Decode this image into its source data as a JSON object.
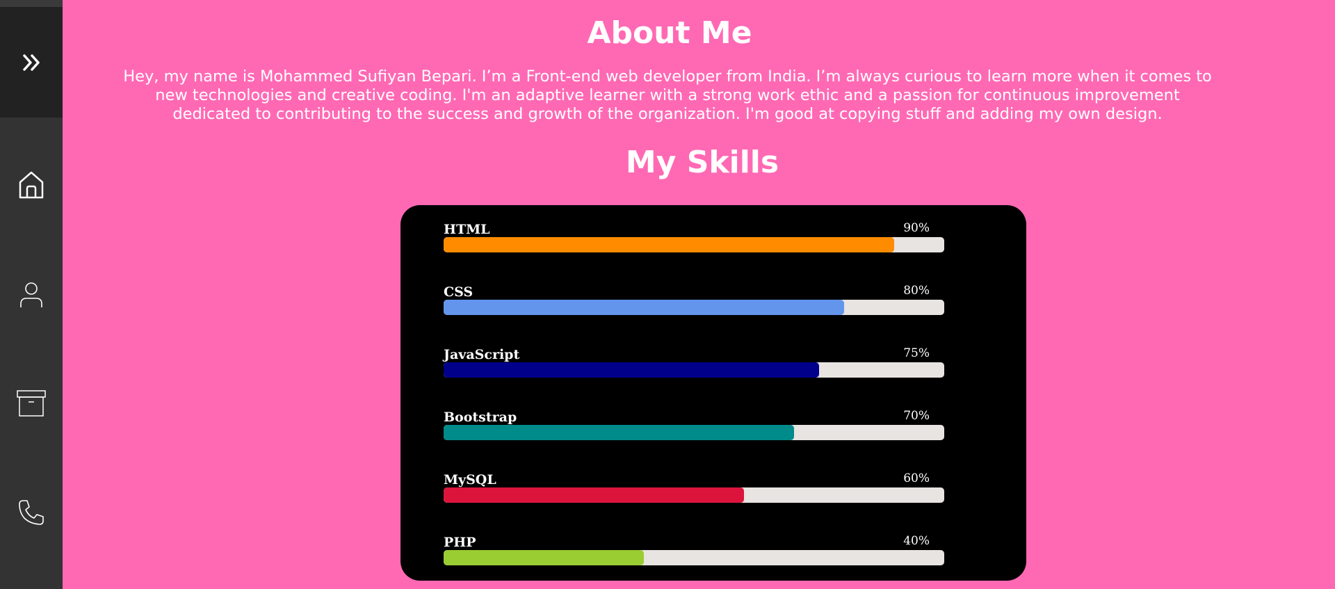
{
  "sidebar": {
    "toggle_icon": "double-chevron-right-icon",
    "items": [
      {
        "icon": "home-icon"
      },
      {
        "icon": "user-icon"
      },
      {
        "icon": "archive-box-icon"
      },
      {
        "icon": "phone-icon"
      }
    ]
  },
  "about": {
    "title": "About Me",
    "text": "Hey, my name is Mohammed Sufiyan Bepari. I’m a Front-end web developer from India. I’m always curious to learn more when it comes to new technologies and creative coding. I'm an adaptive learner with a strong work ethic and a passion for continuous improvement dedicated to contributing to the success and growth of the organization. I'm good at copying stuff and adding my own design."
  },
  "skills": {
    "title": "My Skills",
    "items": [
      {
        "name": "HTML",
        "percent_label": "90%",
        "level": 0.9,
        "color": "#ff8c00"
      },
      {
        "name": "CSS",
        "percent_label": "80%",
        "level": 0.8,
        "color": "#6495ed"
      },
      {
        "name": "JavaScript",
        "percent_label": "75%",
        "level": 0.75,
        "color": "#00008b"
      },
      {
        "name": "Bootstrap",
        "percent_label": "70%",
        "level": 0.7,
        "color": "#008b8b"
      },
      {
        "name": "MySQL",
        "percent_label": "60%",
        "level": 0.6,
        "color": "#dc143c"
      },
      {
        "name": "PHP",
        "percent_label": "40%",
        "level": 0.4,
        "color": "#9acd32"
      }
    ]
  },
  "colors": {
    "background": "#ff69b4",
    "sidebar": "#333333",
    "sidebar_toggle": "#222222",
    "card": "#000000",
    "track": "#e8e4e2"
  }
}
